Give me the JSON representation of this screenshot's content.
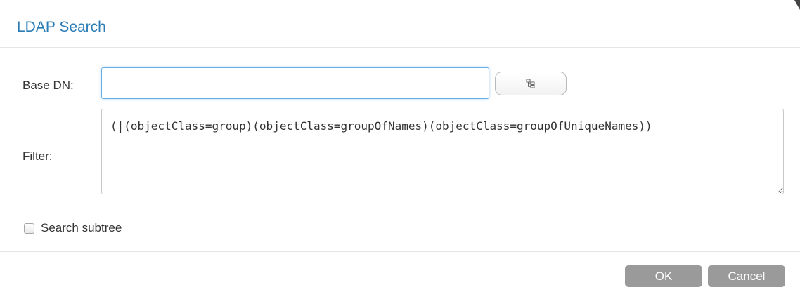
{
  "dialog": {
    "title": "LDAP Search"
  },
  "form": {
    "base_dn": {
      "label": "Base DN:",
      "value": ""
    },
    "browse_icon": "tree-structure-icon",
    "filter": {
      "label": "Filter:",
      "value": "(|(objectClass=group)(objectClass=groupOfNames)(objectClass=groupOfUniqueNames))"
    },
    "search_subtree": {
      "label": "Search subtree",
      "checked": false
    }
  },
  "footer": {
    "ok_label": "OK",
    "cancel_label": "Cancel"
  },
  "colors": {
    "title": "#2b7cb5",
    "focus_border": "#66afe9",
    "button_bg": "#9a9a9a"
  }
}
